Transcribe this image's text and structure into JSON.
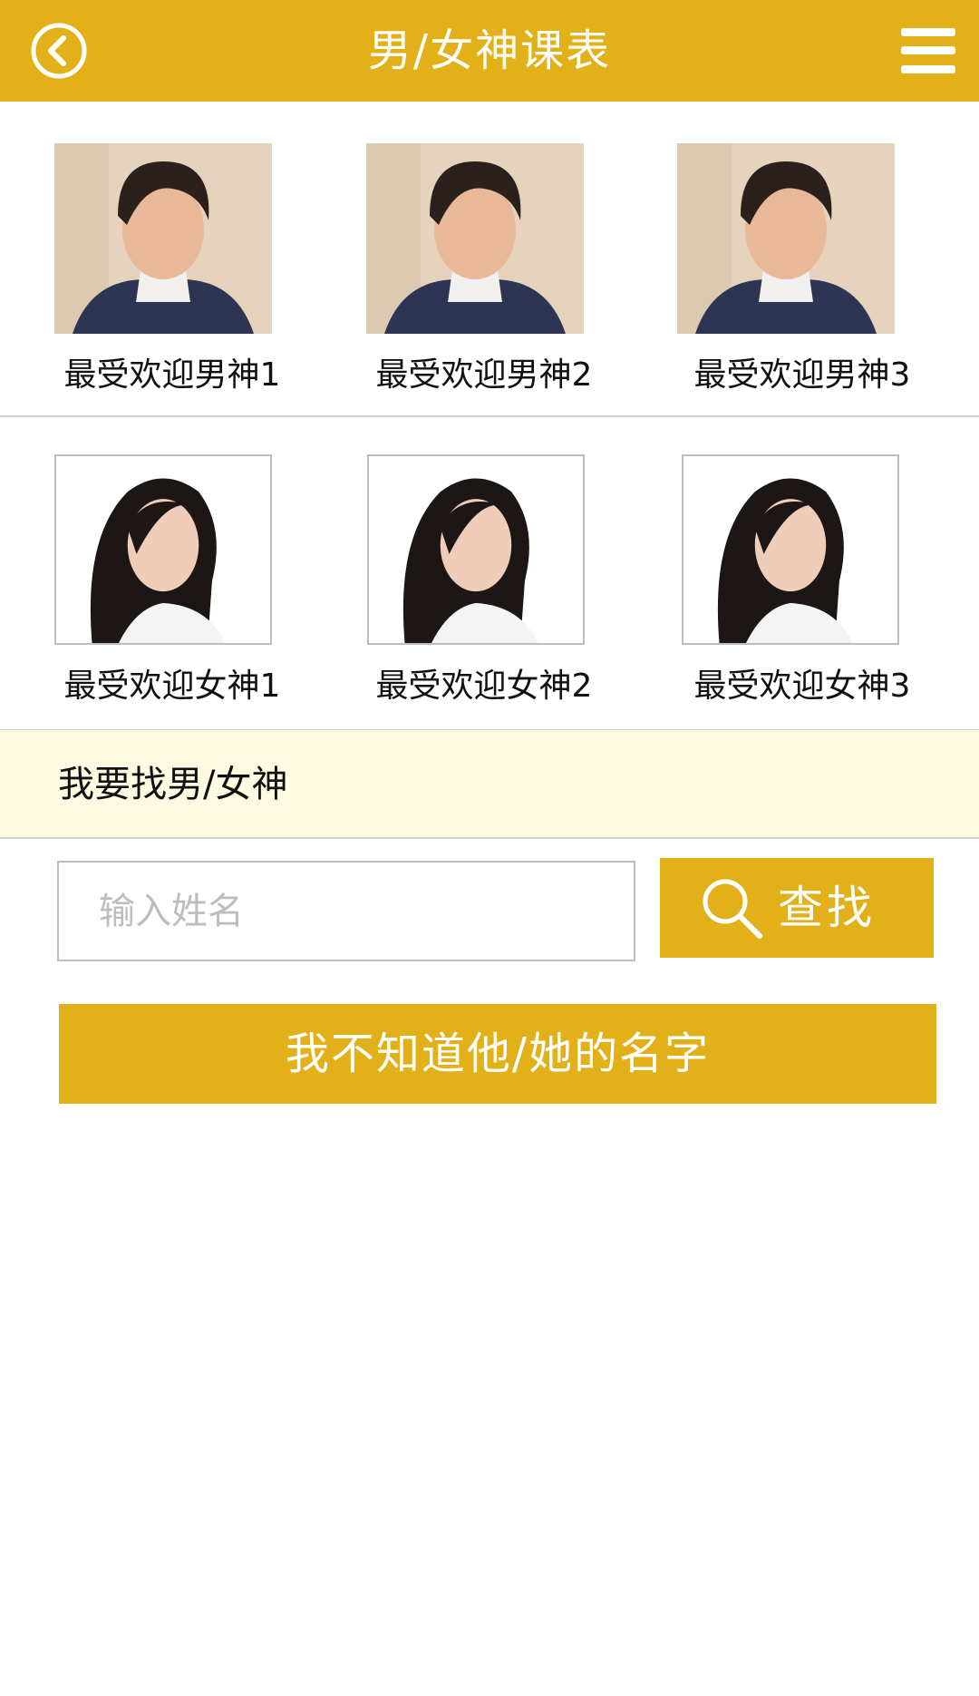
{
  "header": {
    "title": "男/女神课表",
    "back_icon": "back-circle-icon",
    "menu_icon": "hamburger-menu-icon"
  },
  "male_gods": [
    {
      "label": "最受欢迎男神1"
    },
    {
      "label": "最受欢迎男神2"
    },
    {
      "label": "最受欢迎男神3"
    }
  ],
  "female_gods": [
    {
      "label": "最受欢迎女神1"
    },
    {
      "label": "最受欢迎女神2"
    },
    {
      "label": "最受欢迎女神3"
    }
  ],
  "search_section": {
    "title": "我要找男/女神",
    "input_placeholder": "输入姓名",
    "input_value": "",
    "search_button_label": "查找",
    "search_icon": "search-icon",
    "unknown_name_button_label": "我不知道他/她的名字"
  },
  "colors": {
    "accent": "#e2b11a",
    "section_bg": "#fffbe3",
    "divider": "#cfcfcf"
  }
}
